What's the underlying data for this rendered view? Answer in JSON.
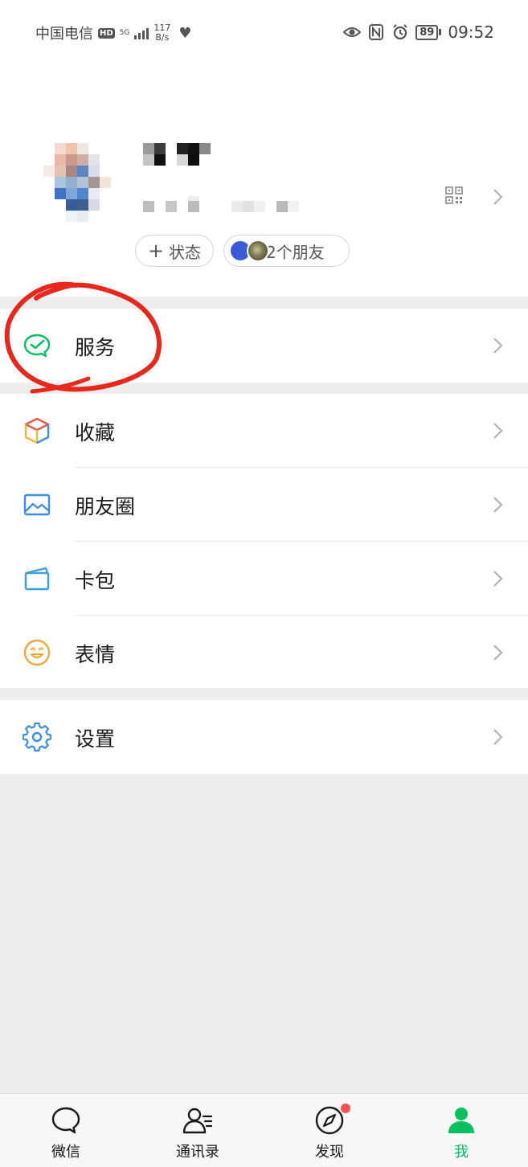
{
  "status_bar": {
    "carrier": "中国电信",
    "hd": "HD",
    "network": "5G",
    "speed_value": "117",
    "speed_unit": "B/s",
    "battery": "89",
    "time": "09:52"
  },
  "profile": {
    "status_label": "状态",
    "friends_label": "2个朋友"
  },
  "menu": {
    "service": "服务",
    "favorites": "收藏",
    "moments": "朋友圈",
    "cards": "卡包",
    "stickers": "表情",
    "settings": "设置"
  },
  "tabbar": {
    "chats": "微信",
    "contacts": "通讯录",
    "discover": "发现",
    "me": "我"
  },
  "colors": {
    "accent_green": "#07c160",
    "badge_red": "#fa5151",
    "annotation_red": "#e8281c"
  }
}
